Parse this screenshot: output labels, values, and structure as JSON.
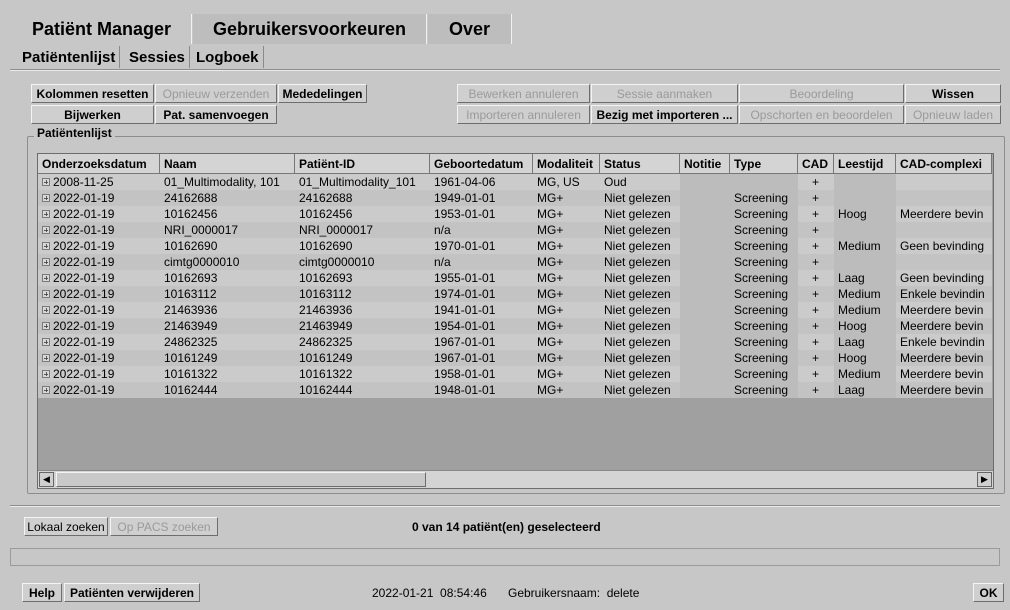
{
  "top_tabs": [
    {
      "label": "Patiënt Manager"
    },
    {
      "label": "Gebruikersvoorkeuren"
    },
    {
      "label": "Over"
    }
  ],
  "sub_tabs": [
    {
      "label": "Patiëntenlijst"
    },
    {
      "label": "Sessies"
    },
    {
      "label": "Logboek"
    }
  ],
  "toolbar": {
    "kolommen_resetten": "Kolommen resetten",
    "opnieuw_verzenden": "Opnieuw verzenden",
    "mededelingen": "Mededelingen",
    "bijwerken": "Bijwerken",
    "pat_samenvoegen": "Pat. samenvoegen",
    "bewerken_annuleren": "Bewerken annuleren",
    "sessie_aanmaken": "Sessie aanmaken",
    "beoordeling": "Beoordeling",
    "wissen": "Wissen",
    "importeren_annuleren": "Importeren annuleren",
    "bezig_met_importeren": "Bezig met importeren ...",
    "opschorten_en_beoordelen": "Opschorten en beoordelen",
    "opnieuw_laden": "Opnieuw laden"
  },
  "patient_list": {
    "group_label": "Patiëntenlijst",
    "columns": [
      "Onderzoeksdatum",
      "Naam",
      "Patiënt-ID",
      "Geboortedatum",
      "Modaliteit",
      "Status",
      "Notitie",
      "Type",
      "CAD",
      "Leestijd",
      "CAD-complexi"
    ],
    "rows": [
      [
        "2008-11-25",
        "01_Multimodality, 101",
        "01_Multimodality_101",
        "1961-04-06",
        "MG, US",
        "Oud",
        "",
        "",
        "+",
        "",
        ""
      ],
      [
        "2022-01-19",
        "24162688",
        "24162688",
        "1949-01-01",
        "MG+",
        "Niet gelezen",
        "",
        "Screening",
        "+",
        "",
        ""
      ],
      [
        "2022-01-19",
        "10162456",
        "10162456",
        "1953-01-01",
        "MG+",
        "Niet gelezen",
        "",
        "Screening",
        "+",
        "Hoog",
        "Meerdere bevin"
      ],
      [
        "2022-01-19",
        "NRI_0000017",
        "NRI_0000017",
        "n/a",
        "MG+",
        "Niet gelezen",
        "",
        "Screening",
        "+",
        "",
        ""
      ],
      [
        "2022-01-19",
        "10162690",
        "10162690",
        "1970-01-01",
        "MG+",
        "Niet gelezen",
        "",
        "Screening",
        "+",
        "Medium",
        "Geen bevinding"
      ],
      [
        "2022-01-19",
        "cimtg0000010",
        "cimtg0000010",
        "n/a",
        "MG+",
        "Niet gelezen",
        "",
        "Screening",
        "+",
        "",
        ""
      ],
      [
        "2022-01-19",
        "10162693",
        "10162693",
        "1955-01-01",
        "MG+",
        "Niet gelezen",
        "",
        "Screening",
        "+",
        "Laag",
        "Geen bevinding"
      ],
      [
        "2022-01-19",
        "10163112",
        "10163112",
        "1974-01-01",
        "MG+",
        "Niet gelezen",
        "",
        "Screening",
        "+",
        "Medium",
        "Enkele bevindin"
      ],
      [
        "2022-01-19",
        "21463936",
        "21463936",
        "1941-01-01",
        "MG+",
        "Niet gelezen",
        "",
        "Screening",
        "+",
        "Medium",
        "Meerdere bevin"
      ],
      [
        "2022-01-19",
        "21463949",
        "21463949",
        "1954-01-01",
        "MG+",
        "Niet gelezen",
        "",
        "Screening",
        "+",
        "Hoog",
        "Meerdere bevin"
      ],
      [
        "2022-01-19",
        "24862325",
        "24862325",
        "1967-01-01",
        "MG+",
        "Niet gelezen",
        "",
        "Screening",
        "+",
        "Laag",
        "Enkele bevindin"
      ],
      [
        "2022-01-19",
        "10161249",
        "10161249",
        "1967-01-01",
        "MG+",
        "Niet gelezen",
        "",
        "Screening",
        "+",
        "Hoog",
        "Meerdere bevin"
      ],
      [
        "2022-01-19",
        "10161322",
        "10161322",
        "1958-01-01",
        "MG+",
        "Niet gelezen",
        "",
        "Screening",
        "+",
        "Medium",
        "Meerdere bevin"
      ],
      [
        "2022-01-19",
        "10162444",
        "10162444",
        "1948-01-01",
        "MG+",
        "Niet gelezen",
        "",
        "Screening",
        "+",
        "Laag",
        "Meerdere bevin"
      ]
    ]
  },
  "search": {
    "lokaal_zoeken": "Lokaal zoeken",
    "op_pacs_zoeken": "Op PACS zoeken",
    "selection_status": "0 van 14 patiënt(en) geselecteerd"
  },
  "footer": {
    "help": "Help",
    "patienten_verwijderen": "Patiënten verwijderen",
    "datetime": "2022-01-21  08:54:46",
    "username": "Gebruikersnaam:  delete",
    "ok": "OK"
  },
  "icons": {
    "scroll_left": "arrow-left-icon",
    "scroll_right": "arrow-right-icon",
    "expand": "plus-expand-icon"
  },
  "colors": {
    "background": "#c7c7c7",
    "grid_empty": "#a0a0a0",
    "disabled_text": "#9a9a9a"
  }
}
